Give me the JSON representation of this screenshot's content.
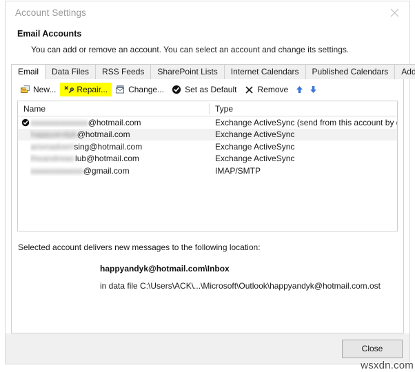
{
  "window": {
    "title": "Account Settings",
    "close_icon": "close-x-icon"
  },
  "header": {
    "title": "Email Accounts",
    "description": "You can add or remove an account. You can select an account and change its settings."
  },
  "tabs": [
    {
      "label": "Email",
      "active": true
    },
    {
      "label": "Data Files",
      "active": false
    },
    {
      "label": "RSS Feeds",
      "active": false
    },
    {
      "label": "SharePoint Lists",
      "active": false
    },
    {
      "label": "Internet Calendars",
      "active": false
    },
    {
      "label": "Published Calendars",
      "active": false
    },
    {
      "label": "Address Books",
      "active": false
    }
  ],
  "toolbar": {
    "new_label": "New...",
    "new_icon": "new-mail-icon",
    "repair_label": "Repair...",
    "repair_icon": "repair-tools-icon",
    "repair_highlight_color": "#ffff00",
    "change_label": "Change...",
    "change_icon": "change-account-icon",
    "set_default_label": "Set as Default",
    "set_default_icon": "check-circle-icon",
    "remove_label": "Remove",
    "remove_icon": "remove-x-icon",
    "move_up_icon": "arrow-up-icon",
    "move_down_icon": "arrow-down-icon",
    "arrow_color": "#3a76d8"
  },
  "list": {
    "columns": [
      "Name",
      "Type"
    ],
    "rows": [
      {
        "name_redacted": "aaaaaaaaaaaa",
        "name_suffix": "@hotmail.com",
        "type": "Exchange ActiveSync (send from this account by def...",
        "default": true,
        "selected": false
      },
      {
        "name_redacted": "happyandyk",
        "name_suffix": "@hotmail.com",
        "type": "Exchange ActiveSync",
        "default": false,
        "selected": true
      },
      {
        "name_redacted": "arionadvert",
        "name_suffix": "sing@hotmail.com",
        "type": "Exchange ActiveSync",
        "default": false,
        "selected": false
      },
      {
        "name_redacted": "theandrewc",
        "name_suffix": "lub@hotmail.com",
        "type": "Exchange ActiveSync",
        "default": false,
        "selected": false
      },
      {
        "name_redacted": "aaaaaaaaaaa",
        "name_suffix": "@gmail.com",
        "type": "IMAP/SMTP",
        "default": false,
        "selected": false
      }
    ]
  },
  "delivery": {
    "lead": "Selected account delivers new messages to the following location:",
    "target": "happyandyk@hotmail.com\\Inbox",
    "path": "in data file C:\\Users\\ACK\\...\\Microsoft\\Outlook\\happyandyk@hotmail.com.ost"
  },
  "footer": {
    "close_label": "Close"
  },
  "watermark": {
    "text": "wsxdn.com"
  }
}
